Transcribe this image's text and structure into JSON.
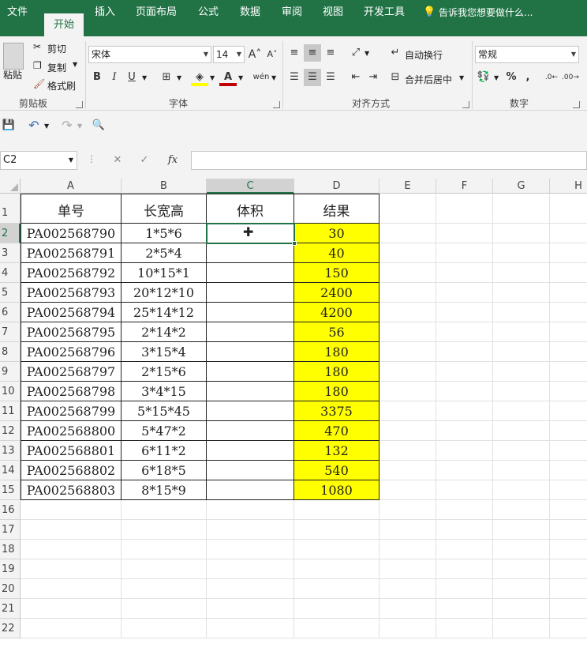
{
  "tabs": [
    {
      "label": "文件",
      "active": false
    },
    {
      "label": "开始",
      "active": true
    },
    {
      "label": "插入",
      "active": false
    },
    {
      "label": "页面布局",
      "active": false
    },
    {
      "label": "公式",
      "active": false
    },
    {
      "label": "数据",
      "active": false
    },
    {
      "label": "审阅",
      "active": false
    },
    {
      "label": "视图",
      "active": false
    },
    {
      "label": "开发工具",
      "active": false
    }
  ],
  "tell_me": "告诉我您想要做什么...",
  "ribbon": {
    "clipboard": {
      "label": "剪贴板",
      "paste": "粘贴",
      "cut": "剪切",
      "copy": "复制",
      "format_painter": "格式刷"
    },
    "font": {
      "label": "字体",
      "font_name": "宋体",
      "font_size": "14",
      "bold": "B",
      "italic": "I",
      "underline": "U",
      "phonetic": "wén"
    },
    "alignment": {
      "label": "对齐方式",
      "wrap_text": "自动换行",
      "merge_center": "合并后居中"
    },
    "number": {
      "label": "数字",
      "format": "常规",
      "percent": "%",
      "comma": ","
    }
  },
  "formula_bar": {
    "name_box": "C2",
    "formula": "",
    "fx": "fx"
  },
  "sheet": {
    "columns": [
      "A",
      "B",
      "C",
      "D",
      "E",
      "F",
      "G",
      "H"
    ],
    "selected_column": "C",
    "selected_row": 2,
    "rows": [
      "1",
      "2",
      "3",
      "4",
      "5",
      "6",
      "7",
      "8",
      "9",
      "10",
      "11",
      "12",
      "13",
      "14",
      "15",
      "16",
      "17",
      "18",
      "19",
      "20",
      "21",
      "22"
    ],
    "headers": [
      "单号",
      "长宽高",
      "体积",
      "结果"
    ],
    "data": [
      [
        "PA002568790",
        "1*5*6",
        "",
        "30"
      ],
      [
        "PA002568791",
        "2*5*4",
        "",
        "40"
      ],
      [
        "PA002568792",
        "10*15*1",
        "",
        "150"
      ],
      [
        "PA002568793",
        "20*12*10",
        "",
        "2400"
      ],
      [
        "PA002568794",
        "25*14*12",
        "",
        "4200"
      ],
      [
        "PA002568795",
        "2*14*2",
        "",
        "56"
      ],
      [
        "PA002568796",
        "3*15*4",
        "",
        "180"
      ],
      [
        "PA002568797",
        "2*15*6",
        "",
        "180"
      ],
      [
        "PA002568798",
        "3*4*15",
        "",
        "180"
      ],
      [
        "PA002568799",
        "5*15*45",
        "",
        "3375"
      ],
      [
        "PA002568800",
        "5*47*2",
        "",
        "470"
      ],
      [
        "PA002568801",
        "6*11*2",
        "",
        "132"
      ],
      [
        "PA002568802",
        "6*18*5",
        "",
        "540"
      ],
      [
        "PA002568803",
        "8*15*9",
        "",
        "1080"
      ]
    ],
    "highlight_color": "#FFFF00",
    "accent_color": "#217346"
  }
}
